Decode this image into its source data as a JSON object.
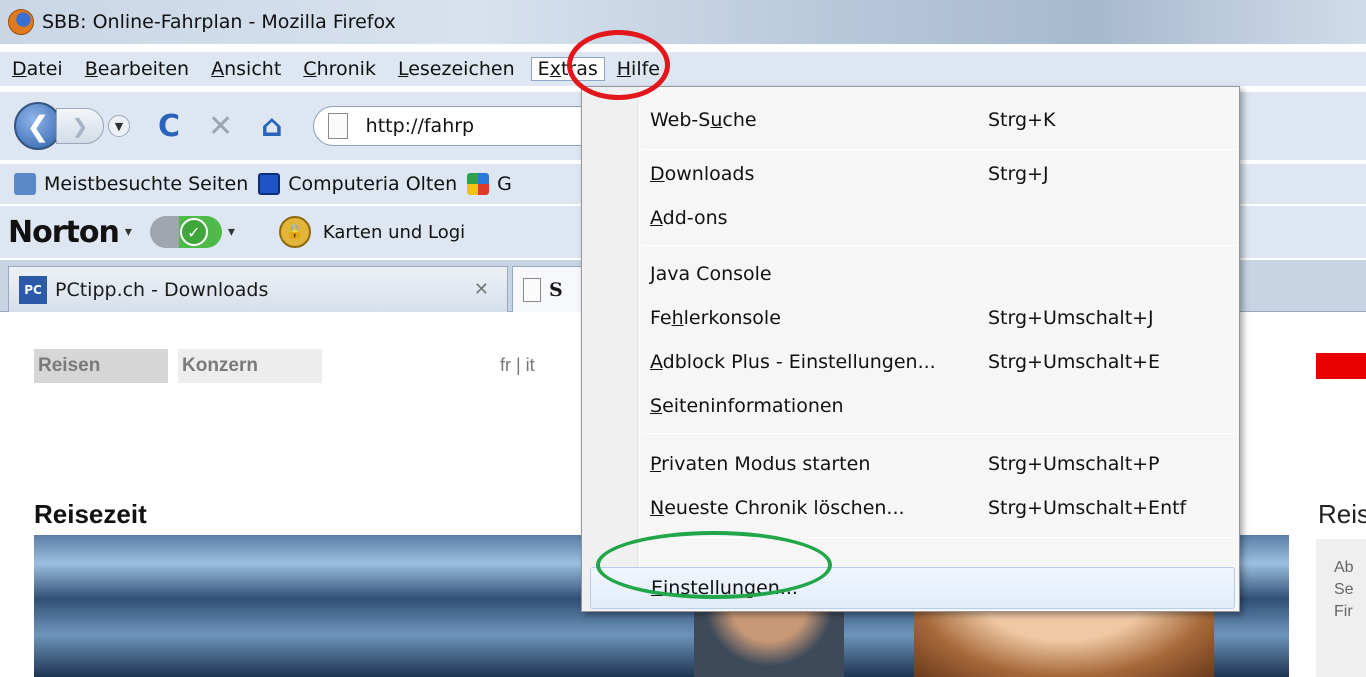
{
  "window": {
    "title": "SBB: Online-Fahrplan - Mozilla Firefox"
  },
  "menubar": {
    "items": [
      {
        "label": "Datei",
        "key": "D",
        "rest": "atei"
      },
      {
        "label": "Bearbeiten",
        "key": "B",
        "rest": "earbeiten"
      },
      {
        "label": "Ansicht",
        "key": "A",
        "rest": "nsicht"
      },
      {
        "label": "Chronik",
        "key": "C",
        "rest": "hronik"
      },
      {
        "label": "Lesezeichen",
        "key": "L",
        "rest": "esezeichen"
      },
      {
        "label": "Extras",
        "pre": "E",
        "key": "x",
        "rest": "tras"
      },
      {
        "label": "Hilfe",
        "key": "H",
        "rest": "ilfe"
      }
    ]
  },
  "navbar": {
    "url": "http://fahrp"
  },
  "bookmarks": {
    "items": [
      "Meistbesuchte Seiten",
      "Computeria Olten",
      "G"
    ]
  },
  "norton": {
    "logo": "Norton",
    "dropdown": "▾",
    "item": "Karten und Logi"
  },
  "tabs": [
    {
      "label": "PCtipp.ch - Downloads",
      "favicon_text": "PC"
    },
    {
      "label": "S"
    }
  ],
  "page": {
    "nav": [
      "Reisen",
      "Konzern"
    ],
    "langs": "fr  |  it",
    "heading": "Reisezeit",
    "side_heading": "Reis",
    "side_lines": [
      "Ab",
      "Se",
      "Fir"
    ]
  },
  "extras_menu": {
    "items": [
      {
        "pre": "Web-S",
        "key": "u",
        "post": "che",
        "shortcut": "Strg+K"
      },
      {
        "pre": "",
        "key": "D",
        "post": "ownloads",
        "shortcut": "Strg+J"
      },
      {
        "pre": "",
        "key": "A",
        "post": "dd-ons",
        "shortcut": ""
      },
      {
        "pre": "",
        "key": "J",
        "post": "ava Console",
        "shortcut": ""
      },
      {
        "pre": "Fe",
        "key": "h",
        "post": "lerkonsole",
        "shortcut": "Strg+Umschalt+J"
      },
      {
        "pre": "",
        "key": "A",
        "post": "dblock Plus - Einstellungen...",
        "shortcut": "Strg+Umschalt+E"
      },
      {
        "pre": "",
        "key": "S",
        "post": "eiteninformationen",
        "shortcut": ""
      },
      {
        "pre": "",
        "key": "P",
        "post": "rivaten Modus starten",
        "shortcut": "Strg+Umschalt+P"
      },
      {
        "pre": "",
        "key": "N",
        "post": "eueste Chronik löschen...",
        "shortcut": "Strg+Umschalt+Entf"
      },
      {
        "pre": "",
        "key": "E",
        "post": "instellungen...",
        "shortcut": ""
      }
    ]
  },
  "annotations": {
    "red_circle_color": "#e2161b",
    "green_circle_color": "#21a64a"
  }
}
